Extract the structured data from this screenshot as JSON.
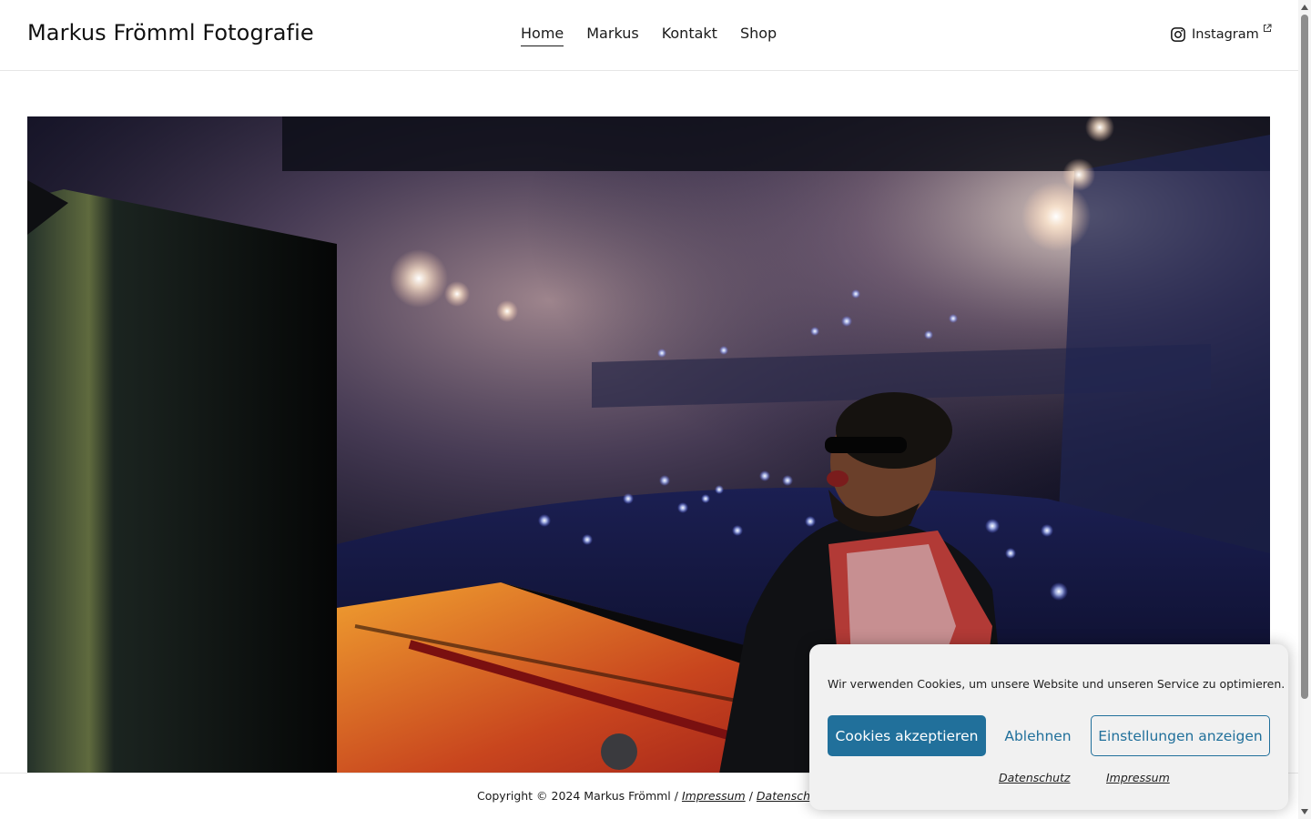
{
  "header": {
    "site_title": "Markus Frömml Fotografie",
    "nav": [
      {
        "label": "Home",
        "active": true
      },
      {
        "label": "Markus",
        "active": false
      },
      {
        "label": "Kontakt",
        "active": false
      },
      {
        "label": "Shop",
        "active": false
      }
    ],
    "social": {
      "label": "Instagram",
      "icon": "instagram-icon",
      "external_icon": "external-link-icon"
    }
  },
  "hero": {
    "image_alt": "Konzertfoto: Pianist mit Sonnenbrille singt am Flügel vor Publikum mit Handylichtern",
    "icon": "photo"
  },
  "footer": {
    "copyright": "Copyright © 2024 Markus Frömml /",
    "separator": "/",
    "impressum": "Impressum",
    "datenschutz": "Datenschu"
  },
  "cookie_banner": {
    "message": "Wir verwenden Cookies, um unsere Website und unseren Service zu optimieren.",
    "accept": "Cookies akzeptieren",
    "deny": "Ablehnen",
    "settings": "Einstellungen anzeigen",
    "link_privacy": "Datenschutz",
    "link_imprint": "Impressum",
    "accent_color": "#21709b"
  }
}
